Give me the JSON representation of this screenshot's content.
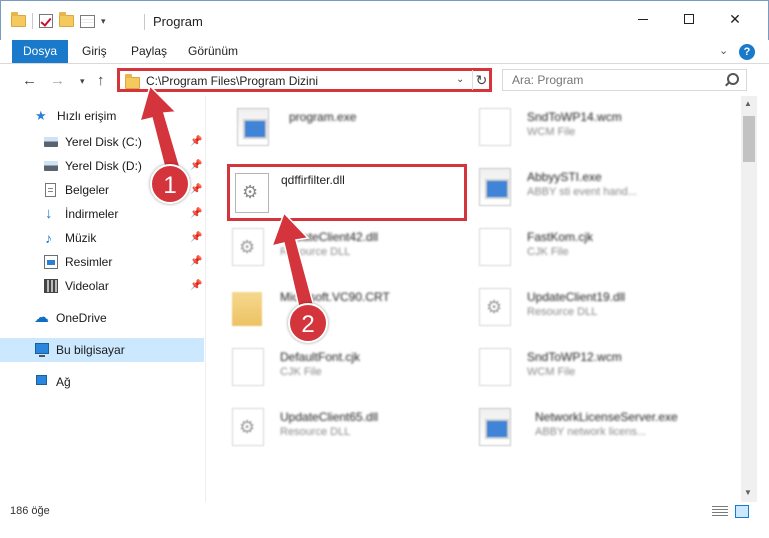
{
  "window": {
    "title": "Program",
    "minimize_icon": "minimize-icon",
    "maximize_icon": "maximize-icon",
    "close_glyph": "✕"
  },
  "ribbon": {
    "tabs": [
      "Dosya",
      "Giriş",
      "Paylaş",
      "Görünüm"
    ],
    "help_glyph": "?",
    "collapse_glyph": "⌄"
  },
  "nav": {
    "back_glyph": "←",
    "forward_glyph": "→",
    "recent_glyph": "▾",
    "up_glyph": "↑",
    "address": "C:\\Program Files\\Program Dizini",
    "address_dropdown_glyph": "⌄",
    "refresh_glyph": "↻",
    "search_placeholder": "Ara: Program"
  },
  "sidebar": {
    "items": [
      {
        "label": "Hızlı erişim",
        "icon": "star-icon"
      },
      {
        "label": "Yerel Disk (C:)",
        "icon": "disk-icon",
        "pinned": true
      },
      {
        "label": "Yerel Disk (D:)",
        "icon": "disk-icon",
        "pinned": true
      },
      {
        "label": "Belgeler",
        "icon": "document-icon",
        "pinned": true
      },
      {
        "label": "İndirmeler",
        "icon": "download-icon",
        "pinned": true
      },
      {
        "label": "Müzik",
        "icon": "music-icon",
        "pinned": true
      },
      {
        "label": "Resimler",
        "icon": "pictures-icon",
        "pinned": true
      },
      {
        "label": "Videolar",
        "icon": "video-icon",
        "pinned": true
      },
      {
        "label": "OneDrive",
        "icon": "cloud-icon"
      },
      {
        "label": "Bu bilgisayar",
        "icon": "computer-icon",
        "selected": true
      },
      {
        "label": "Ağ",
        "icon": "network-icon"
      }
    ],
    "pin_glyph": "📌"
  },
  "files": {
    "left_column": [
      {
        "name": "program.exe",
        "type": ""
      },
      {
        "name": "qdffirfilter.dll",
        "type": "",
        "highlighted": true
      },
      {
        "name": "UpdateClient42.dll",
        "type": "Resource DLL"
      },
      {
        "name": "Microsoft.VC90.CRT",
        "type": ""
      },
      {
        "name": "DefaultFont.cjk",
        "type": "CJK File"
      },
      {
        "name": "UpdateClient65.dll",
        "type": "Resource DLL"
      }
    ],
    "right_column": [
      {
        "name": "SndToWP14.wcm",
        "type": "WCM File"
      },
      {
        "name": "AbbyySTI.exe",
        "type": "ABBY sti event hand..."
      },
      {
        "name": "FastKom.cjk",
        "type": "CJK File"
      },
      {
        "name": "UpdateClient19.dll",
        "type": "Resource DLL"
      },
      {
        "name": "SndToWP12.wcm",
        "type": "WCM File"
      },
      {
        "name": "NetworkLicenseServer.exe",
        "type": "ABBY network licens..."
      }
    ]
  },
  "status": {
    "item_count": "186 öğe"
  },
  "annotations": {
    "badge_1": "1",
    "badge_2": "2",
    "color": "#d4343b"
  }
}
